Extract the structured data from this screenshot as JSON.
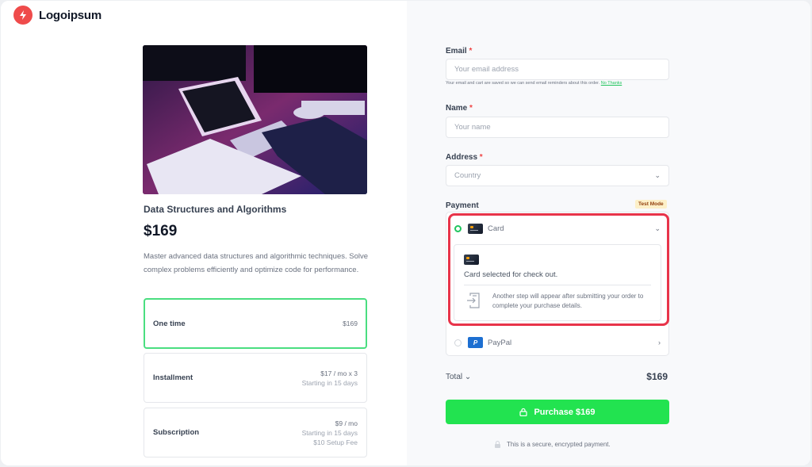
{
  "brand": {
    "name": "Logoipsum",
    "color": "#ef4b4b"
  },
  "product": {
    "title": "Data Structures and Algorithms",
    "price": "$169",
    "description": "Master advanced data structures and algorithmic techniques. Solve complex problems efficiently and optimize code for performance.",
    "image_alt": "Person coding at a desk with flowchart and tablet"
  },
  "plans": [
    {
      "name": "One time",
      "lines": [
        "$169"
      ],
      "selected": true
    },
    {
      "name": "Installment",
      "lines": [
        "$17 / mo x 3",
        "Starting in 15 days"
      ],
      "selected": false
    },
    {
      "name": "Subscription",
      "lines": [
        "$9 / mo",
        "Starting in 15 days",
        "$10 Setup Fee"
      ],
      "selected": false
    }
  ],
  "form": {
    "required_mark": "*",
    "email": {
      "label": "Email",
      "placeholder": "Your email address",
      "value": ""
    },
    "email_hint": "Your email and cart are saved so we can send email reminders about this order.",
    "email_hint_link": "No Thanks",
    "name": {
      "label": "Name",
      "placeholder": "Your name",
      "value": ""
    },
    "address": {
      "label": "Address",
      "placeholder": "Country",
      "value": ""
    }
  },
  "payment": {
    "label": "Payment",
    "badge": "Test Mode",
    "methods": [
      {
        "name": "Card",
        "selected": true,
        "icon": "card-icon"
      },
      {
        "name": "PayPal",
        "selected": false,
        "icon": "paypal-icon"
      }
    ],
    "card_selected_text": "Card selected for check out.",
    "next_step_text": "Another step will appear after submitting your order to complete your purchase details."
  },
  "total": {
    "label": "Total",
    "value": "$169"
  },
  "purchase_button": "Purchase $169",
  "secure_note": "This is a secure, encrypted payment.",
  "colors": {
    "accent": "#22e350",
    "highlight": "#e8344a",
    "badge_bg": "#fdf0c8"
  }
}
